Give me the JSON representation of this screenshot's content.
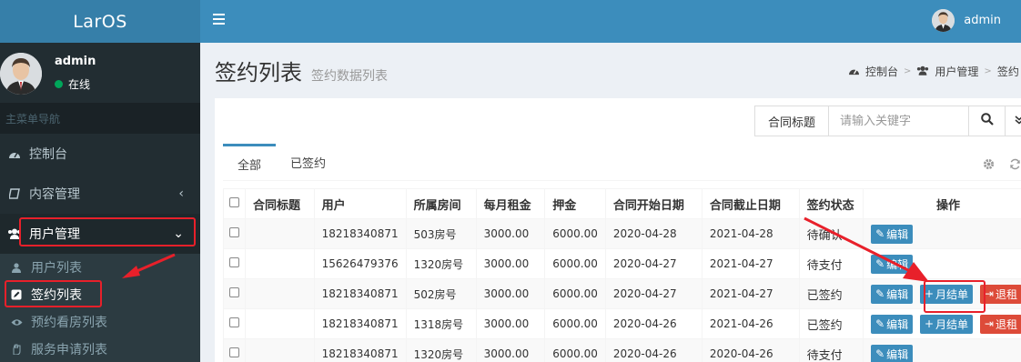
{
  "app": {
    "logo": "LarOS"
  },
  "user": {
    "name": "admin",
    "status": "在线"
  },
  "sidebar": {
    "header": "主菜单导航",
    "items": [
      {
        "label": "控制台",
        "icon": "dashboard-icon"
      },
      {
        "label": "内容管理",
        "icon": "book-icon"
      },
      {
        "label": "用户管理",
        "icon": "users-icon"
      }
    ],
    "sub_items": [
      {
        "label": "用户列表",
        "icon": "user-icon"
      },
      {
        "label": "签约列表",
        "icon": "edit-icon"
      },
      {
        "label": "预约看房列表",
        "icon": "eye-icon"
      },
      {
        "label": "服务申请列表",
        "icon": "hand-icon"
      }
    ]
  },
  "topbar": {
    "user": "admin"
  },
  "page": {
    "title": "签约列表",
    "subtitle": "签约数据列表"
  },
  "breadcrumb": [
    "控制台",
    "用户管理",
    "签约"
  ],
  "search": {
    "label": "合同标题",
    "placeholder": "请输入关键字"
  },
  "tabs": [
    "全部",
    "已签约"
  ],
  "table": {
    "columns": [
      "合同标题",
      "用户",
      "所属房间",
      "每月租金",
      "押金",
      "合同开始日期",
      "合同截止日期",
      "签约状态",
      "操作"
    ],
    "rows": [
      {
        "title": "",
        "user": "18218340871",
        "room": "503房号",
        "rent": "3000.00",
        "deposit": "6000.00",
        "start": "2020-04-28",
        "end": "2021-04-28",
        "status": "待确认",
        "actions": [
          "编辑"
        ]
      },
      {
        "title": "",
        "user": "15626479376",
        "room": "1320房号",
        "rent": "3000.00",
        "deposit": "6000.00",
        "start": "2020-04-27",
        "end": "2021-04-27",
        "status": "待支付",
        "actions": [
          "编辑"
        ]
      },
      {
        "title": "",
        "user": "18218340871",
        "room": "502房号",
        "rent": "3000.00",
        "deposit": "6000.00",
        "start": "2020-04-27",
        "end": "2021-04-27",
        "status": "已签约",
        "actions": [
          "编辑",
          "月结单",
          "退租"
        ]
      },
      {
        "title": "",
        "user": "18218340871",
        "room": "1318房号",
        "rent": "3000.00",
        "deposit": "6000.00",
        "start": "2020-04-26",
        "end": "2021-04-26",
        "status": "已签约",
        "actions": [
          "编辑",
          "月结单",
          "退租"
        ]
      },
      {
        "title": "",
        "user": "18218340871",
        "room": "1320房号",
        "rent": "3000.00",
        "deposit": "6000.00",
        "start": "2020-04-26",
        "end": "2020-04-26",
        "status": "待支付",
        "actions": [
          "编辑"
        ]
      }
    ]
  },
  "colors": {
    "primary": "#3c8dbc",
    "danger": "#dd4b39",
    "sidebar": "#222d32",
    "annotation": "#e8202a"
  }
}
